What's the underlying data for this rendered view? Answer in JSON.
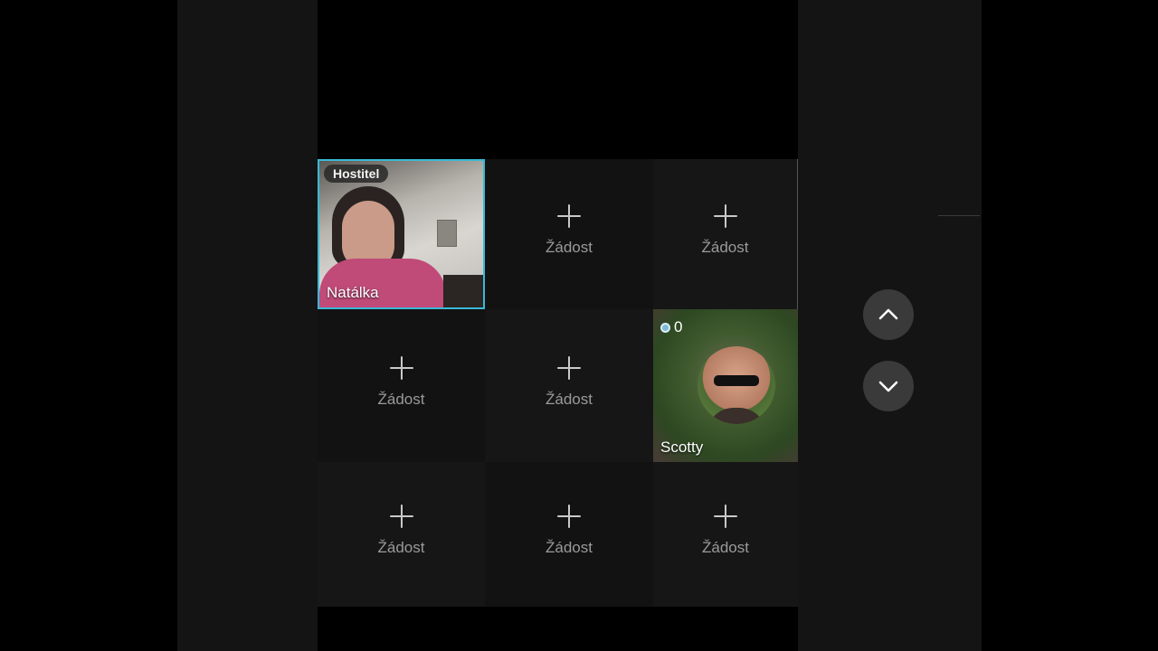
{
  "host_tile": {
    "badge": "Hostitel",
    "name": "Natálka"
  },
  "request_label": "Žádost",
  "guest_tile": {
    "name": "Scotty",
    "count": "0"
  },
  "colors": {
    "host_border": "#39b9d6",
    "background": "#000000",
    "panel": "#141414"
  },
  "icons": {
    "scroll_up": "chevron-up-icon",
    "scroll_down": "chevron-down-icon",
    "add": "plus-icon"
  }
}
